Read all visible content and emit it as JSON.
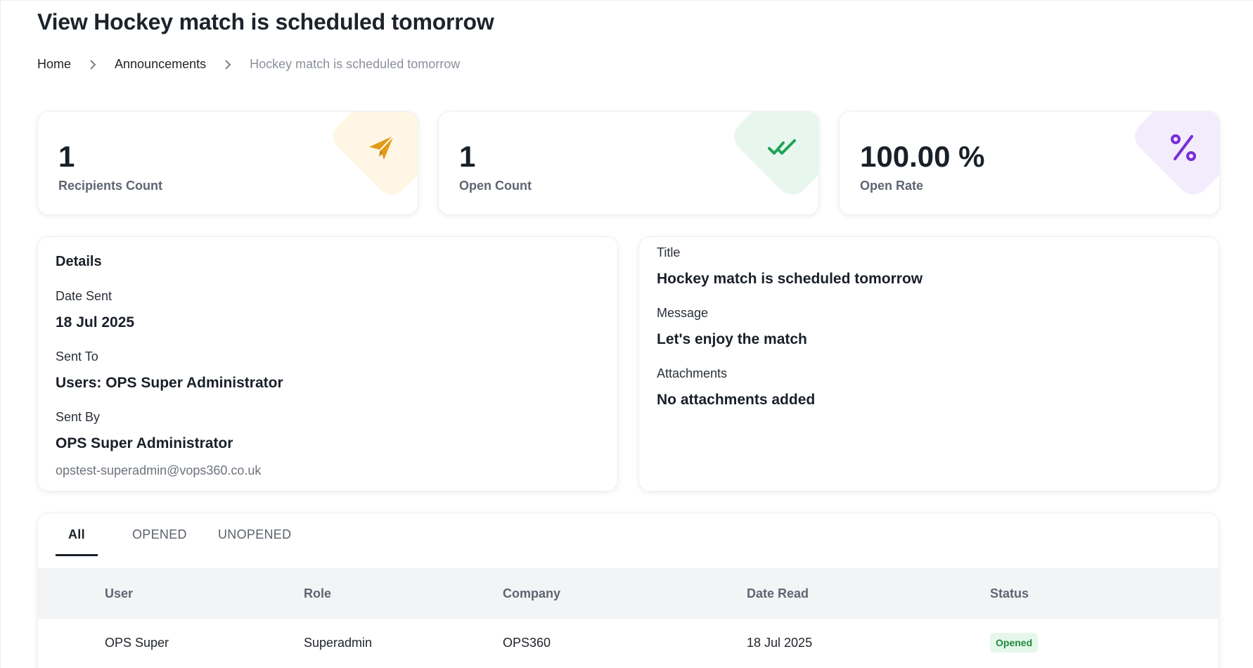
{
  "header": {
    "title": "View Hockey match is scheduled tomorrow"
  },
  "breadcrumb": {
    "items": [
      "Home",
      "Announcements",
      "Hockey match is scheduled tomorrow"
    ]
  },
  "stats": [
    {
      "value": "1",
      "label": "Recipients Count",
      "icon": "paper-plane-icon",
      "color": "#e39a17",
      "bg": "#fff6e6"
    },
    {
      "value": "1",
      "label": "Open Count",
      "icon": "double-check-icon",
      "color": "#1fa357",
      "bg": "#e8f7ee"
    },
    {
      "value": "100.00 %",
      "label": "Open Rate",
      "icon": "percent-icon",
      "color": "#7a2ed6",
      "bg": "#f3ecfd"
    }
  ],
  "details": {
    "heading": "Details",
    "date_sent_label": "Date Sent",
    "date_sent_value": "18 Jul 2025",
    "sent_to_label": "Sent To",
    "sent_to_value": "Users: OPS Super Administrator",
    "sent_by_label": "Sent By",
    "sent_by_value": "OPS Super Administrator",
    "sent_by_email": "opstest-superadmin@vops360.co.uk"
  },
  "content": {
    "title_label": "Title",
    "title_value": "Hockey match is scheduled tomorrow",
    "message_label": "Message",
    "message_value": "Let's enjoy the match",
    "attachments_label": "Attachments",
    "attachments_value": "No attachments added"
  },
  "tabs": [
    {
      "label": "All",
      "active": true
    },
    {
      "label": "OPENED",
      "active": false
    },
    {
      "label": "UNOPENED",
      "active": false
    }
  ],
  "table": {
    "columns": [
      "User",
      "Role",
      "Company",
      "Date Read",
      "Status"
    ],
    "rows": [
      {
        "user": "OPS Super",
        "role": "Superadmin",
        "company": "OPS360",
        "date_read": "18 Jul 2025",
        "status": "Opened"
      }
    ]
  }
}
